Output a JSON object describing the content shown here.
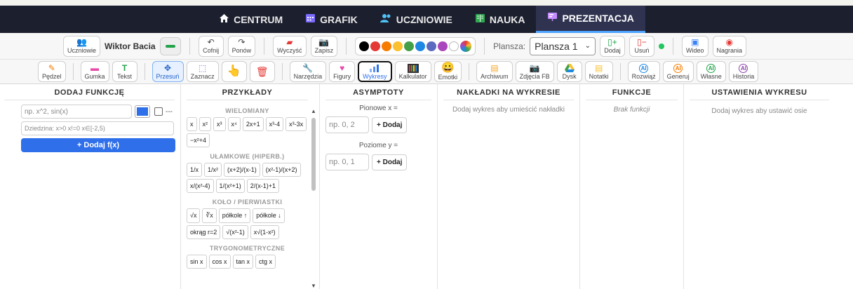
{
  "nav": {
    "items": [
      {
        "label": "CENTRUM",
        "icon": "home-icon"
      },
      {
        "label": "GRAFIK",
        "icon": "calendar-icon"
      },
      {
        "label": "UCZNIOWIE",
        "icon": "users-icon"
      },
      {
        "label": "NAUKA",
        "icon": "book-icon"
      },
      {
        "label": "PREZENTACJA",
        "icon": "presentation-icon",
        "active": true
      }
    ]
  },
  "toolbar1": {
    "students_label": "Uczniowie",
    "user_name": "Wiktor Bacia",
    "undo_label": "Cofnij",
    "redo_label": "Ponów",
    "clear_label": "Wyczyść",
    "save_label": "Zapisz",
    "colors": [
      "#000000",
      "#e53935",
      "#f57c00",
      "#fbc02d",
      "#43a047",
      "#1e88e5",
      "#5c6bc0",
      "#ab47bc",
      "#ffffff"
    ],
    "board_label": "Plansza:",
    "board_value": "Plansza 1",
    "add_label": "Dodaj",
    "remove_label": "Usuń",
    "video_label": "Wideo",
    "recordings_label": "Nagrania"
  },
  "toolbar2": {
    "brush_label": "Pędzel",
    "eraser_label": "Gumka",
    "text_label": "Tekst",
    "move_label": "Przesuń",
    "select_label": "Zaznacz",
    "tools_label": "Narzędzia",
    "shapes_label": "Figury",
    "charts_label": "Wykresy",
    "calculator_label": "Kalkulator",
    "emoji_label": "Emotki",
    "archive_label": "Archiwum",
    "photos_label": "Zdjęcia FB",
    "drive_label": "Dysk",
    "notes_label": "Notatki",
    "solve_label": "Rozwiąż",
    "generate_label": "Generuj",
    "custom_label": "Własne",
    "history_label": "Historia"
  },
  "panels": {
    "add_function": {
      "title": "DODAJ FUNKCJĘ",
      "fx_placeholder": "np. x^2, sin(x)",
      "style_label": "---",
      "domain_placeholder": "Dziedzina: x>0  x!=0  x∈[-2,5)",
      "add_button": "+ Dodaj f(x)",
      "color": "#2f6fea"
    },
    "examples": {
      "title": "PRZYKŁADY",
      "categories": [
        {
          "name": "WIELOMIANY",
          "items": [
            "x",
            "x²",
            "x³",
            "x⁴",
            "2x+1",
            "x³-4",
            "x³-3x",
            "−x²+4"
          ]
        },
        {
          "name": "UŁAMKOWE (HIPERB.)",
          "items": [
            "1/x",
            "1/x²",
            "(x+2)/(x-1)",
            "(x²-1)/(x+2)",
            "x/(x²-4)",
            "1/(x²+1)",
            "2/(x-1)+1"
          ]
        },
        {
          "name": "KOŁO / PIERWIASTKI",
          "items": [
            "√x",
            "∛x",
            "półkole ↑",
            "półkole ↓",
            "okrąg r=2",
            "√(x²-1)",
            "x√(1-x²)"
          ]
        },
        {
          "name": "TRYGONOMETRYCZNE",
          "items": [
            "sin x",
            "cos x",
            "tan x",
            "ctg x"
          ]
        }
      ]
    },
    "asymptotes": {
      "title": "ASYMPTOTY",
      "vertical_label": "Pionowe x =",
      "vertical_placeholder": "np. 0, 2",
      "horizontal_label": "Poziome y =",
      "horizontal_placeholder": "np. 0, 1",
      "add_button": "+ Dodaj"
    },
    "overlays": {
      "title": "NAKŁADKI NA WYKRESIE",
      "hint": "Dodaj wykres aby umieścić nakładki"
    },
    "functions": {
      "title": "FUNKCJE",
      "empty": "Brak funkcji"
    },
    "settings": {
      "title": "USTAWIENIA WYKRESU",
      "hint": "Dodaj wykres aby ustawić osie"
    }
  }
}
